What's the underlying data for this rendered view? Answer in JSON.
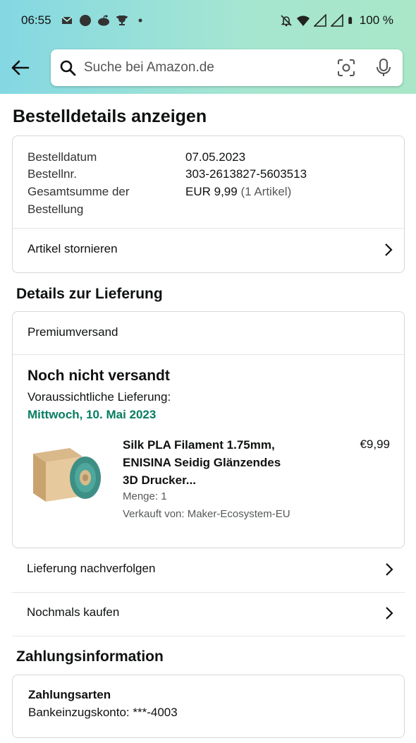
{
  "status_bar": {
    "time": "06:55",
    "battery": "100 %",
    "left_icons": [
      "gmail-icon",
      "circle-icon",
      "reddit-icon",
      "trophy-icon",
      "dot-icon"
    ],
    "right_icons": [
      "notifications-off-icon",
      "wifi-icon",
      "signal-icon",
      "signal-icon",
      "battery-icon"
    ]
  },
  "search": {
    "placeholder": "Suche bei Amazon.de"
  },
  "page_title": "Bestelldetails anzeigen",
  "order": {
    "date_label": "Bestelldatum",
    "date_value": "07.05.2023",
    "number_label": "Bestellnr.",
    "number_value": "303-2613827-5603513",
    "total_label": "Gesamtsumme der Bestellung",
    "total_value": "EUR 9,99",
    "total_items": "(1 Artikel)",
    "cancel_label": "Artikel stornieren"
  },
  "delivery": {
    "section_title": "Details zur Lieferung",
    "shipping_method": "Premiumversand",
    "status": "Noch nicht versandt",
    "eta_label": "Voraussichtliche Lieferung:",
    "eta_date": "Mittwoch, 10. Mai 2023",
    "product": {
      "title": "Silk PLA Filament 1.75mm, ENISINA Seidig Glänzendes 3D Drucker...",
      "price": "€9,99",
      "quantity": "Menge: 1",
      "seller": "Verkauft von: Maker-Ecosystem-EU"
    },
    "track_label": "Lieferung nachverfolgen",
    "buy_again_label": "Nochmals kaufen"
  },
  "payment": {
    "section_title": "Zahlungsinformation",
    "methods_title": "Zahlungsarten",
    "account": "Bankeinzugskonto: ***-4003"
  },
  "colors": {
    "header_gradient_start": "#84d8e3",
    "header_gradient_end": "#a9e7c8",
    "eta_green": "#067d62",
    "card_border": "#d5d9d9"
  }
}
